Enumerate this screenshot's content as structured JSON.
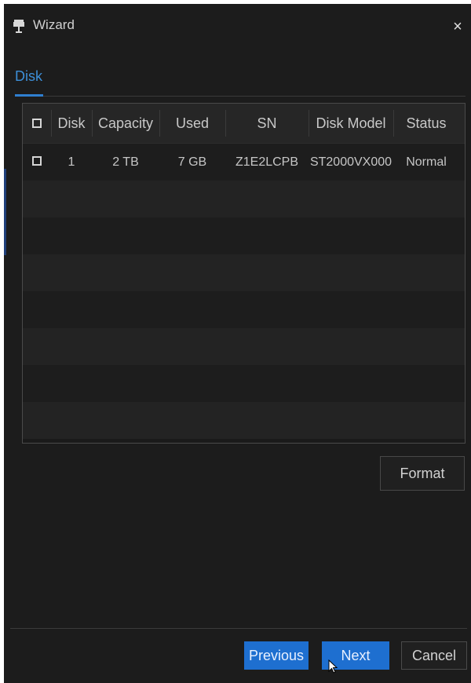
{
  "window": {
    "title": "Wizard",
    "close_glyph": "×",
    "title_icon": "pin-icon"
  },
  "tabs": [
    {
      "label": "Disk",
      "active": true
    }
  ],
  "table": {
    "columns": [
      "Disk",
      "Capacity",
      "Used",
      "SN",
      "Disk Model",
      "Status"
    ],
    "rows": [
      {
        "disk": "1",
        "capacity": "2 TB",
        "used": "7 GB",
        "sn": "Z1E2LCPB",
        "model": "ST2000VX000",
        "status": "Normal"
      }
    ]
  },
  "buttons": {
    "format": "Format",
    "previous": "Previous",
    "next": "Next",
    "cancel": "Cancel"
  },
  "colors": {
    "accent": "#1e6fd0",
    "tab_active": "#3d8fd8",
    "background": "#1c1c1c"
  }
}
